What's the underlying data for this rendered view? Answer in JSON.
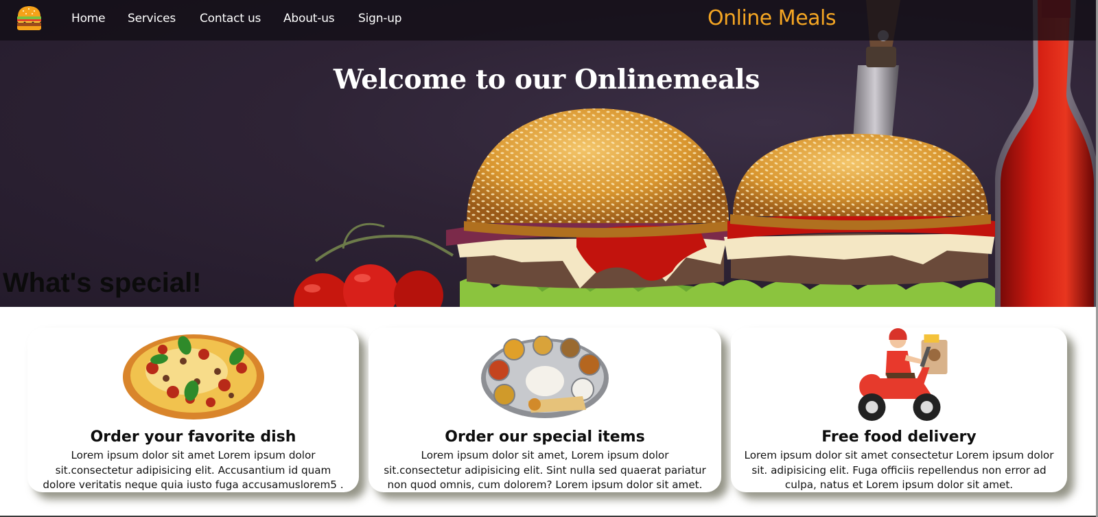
{
  "nav": {
    "logo_icon": "burger-icon",
    "links": [
      {
        "label": "Home"
      },
      {
        "label": "Services"
      },
      {
        "label": "Contact us"
      },
      {
        "label": "About-us"
      },
      {
        "label": "Sign-up"
      }
    ],
    "brand": "Online Meals"
  },
  "hero": {
    "title": "Welcome to our Onlinemeals",
    "special_heading": "What's special!"
  },
  "cards": [
    {
      "image": "pizza-image",
      "title": "Order your favorite dish",
      "text": "Lorem ipsum dolor sit amet Lorem ipsum dolor sit.consectetur adipisicing elit. Accusantium id quam dolore veritatis neque quia iusto fuga accusamuslorem5 ."
    },
    {
      "image": "thali-plate-image",
      "title": "Order our special items",
      "text": "Lorem ipsum dolor sit amet, Lorem ipsum dolor sit.consectetur adipisicing elit. Sint nulla sed quaerat pariatur non quod omnis, cum dolorem? Lorem ipsum dolor sit amet."
    },
    {
      "image": "delivery-scooter-image",
      "title": "Free food delivery",
      "text": "Lorem ipsum dolor sit amet consectetur Lorem ipsum dolor sit. adipisicing elit. Fuga officiis repellendus non error ad culpa, natus et Lorem ipsum dolor sit amet."
    }
  ],
  "colors": {
    "nav_bg": "#120e16",
    "brand": "#f5a623",
    "hero_bg": "#2e2335",
    "card_shadow": "#5a5a46"
  }
}
